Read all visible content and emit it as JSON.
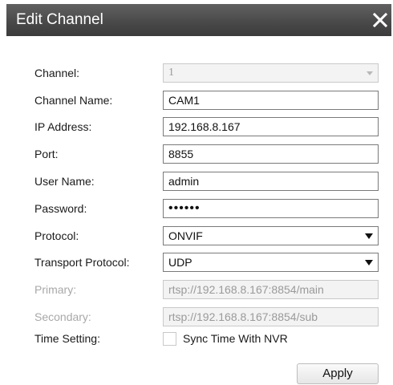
{
  "dialog": {
    "title": "Edit Channel",
    "close_icon": "close-icon"
  },
  "form": {
    "channel": {
      "label": "Channel:",
      "value": "1",
      "enabled": false
    },
    "channel_name": {
      "label": "Channel Name:",
      "value": "CAM1"
    },
    "ip_address": {
      "label": "IP Address:",
      "value": "192.168.8.167"
    },
    "port": {
      "label": "Port:",
      "value": "8855"
    },
    "user_name": {
      "label": "User Name:",
      "value": "admin"
    },
    "password": {
      "label": "Password:",
      "value": "••••••"
    },
    "protocol": {
      "label": "Protocol:",
      "value": "ONVIF"
    },
    "transport_protocol": {
      "label": "Transport Protocol:",
      "value": "UDP"
    },
    "primary": {
      "label": "Primary:",
      "value": "rtsp://192.168.8.167:8854/main",
      "enabled": false
    },
    "secondary": {
      "label": "Secondary:",
      "value": "rtsp://192.168.8.167:8854/sub",
      "enabled": false
    },
    "time_setting": {
      "label": "Time Setting:",
      "checkbox_label": "Sync Time With NVR",
      "checked": false
    }
  },
  "actions": {
    "apply_label": "Apply"
  },
  "colors": {
    "titlebar": "#4a4a4a",
    "title_text": "#ffffff",
    "disabled_text": "#a8a8a8"
  }
}
